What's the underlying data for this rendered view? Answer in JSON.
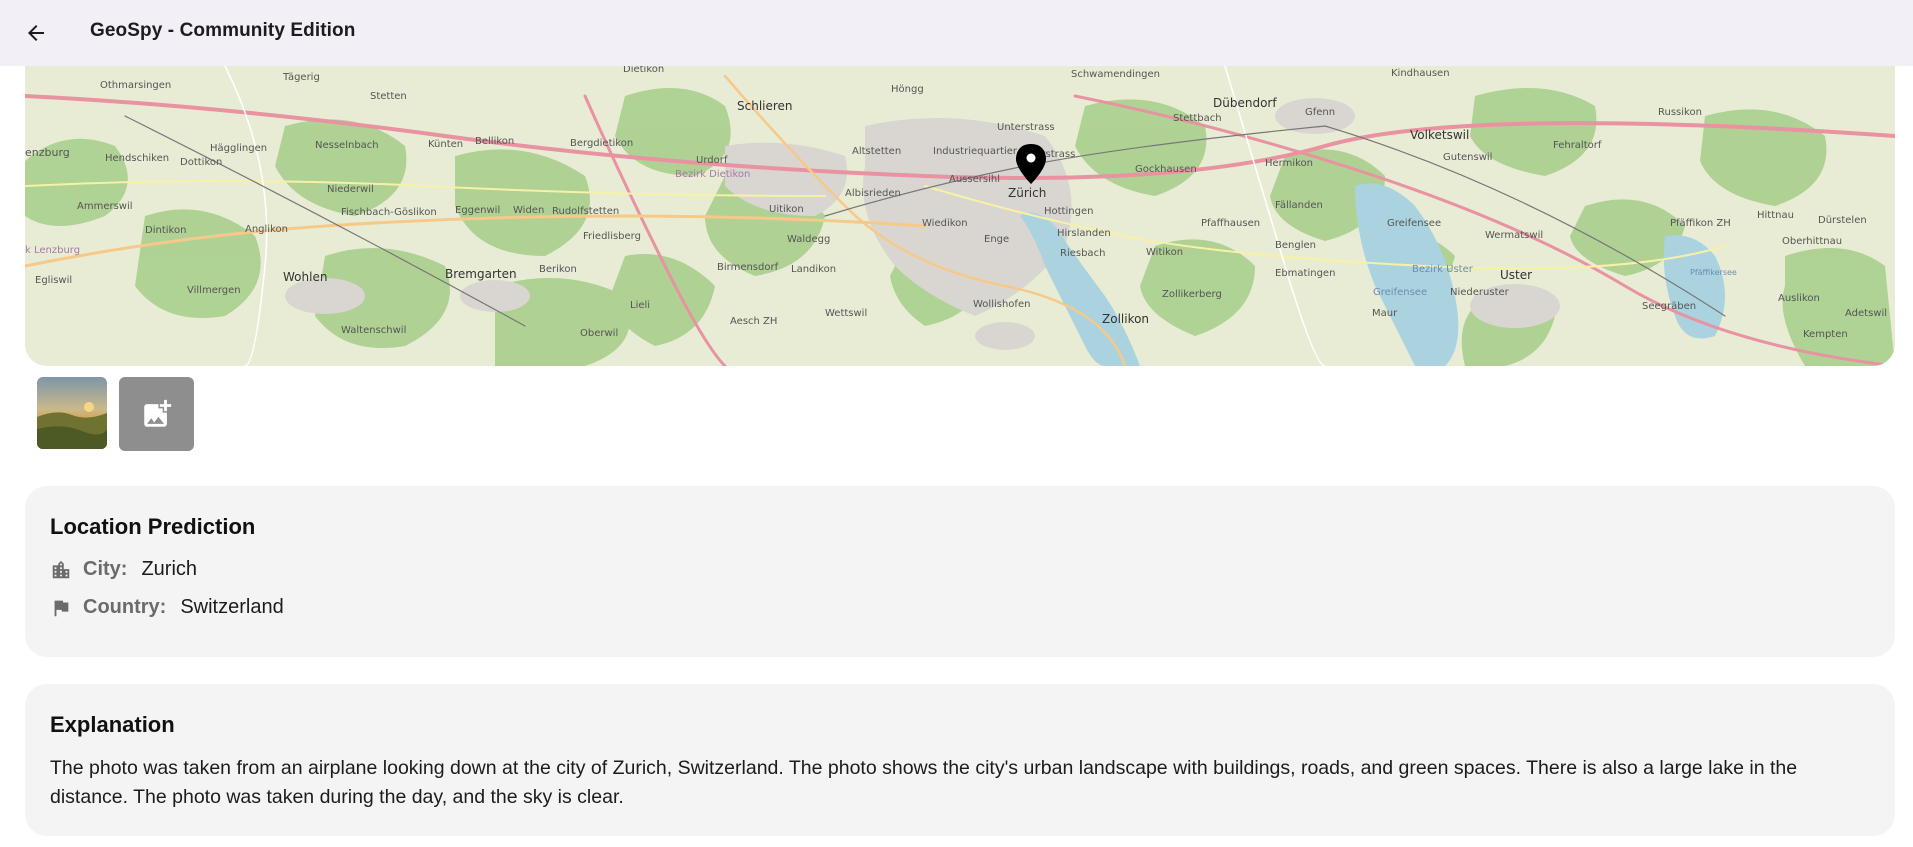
{
  "app": {
    "title": "GeoSpy - Community Edition",
    "back_icon": "arrow-back-icon"
  },
  "map": {
    "marker_icon": "map-pin-icon",
    "labels": [
      "Dietikon",
      "Othmarsingen",
      "Tägerig",
      "Stetten",
      "Schlieren",
      "Höngg",
      "Unterstrass",
      "Oberstrass",
      "Schwamendingen",
      "Dübendorf",
      "Gfenn",
      "Volketswil",
      "Kindhausen",
      "Russikon",
      "Fehraltorf",
      "Gutenswil",
      "Hendschiken",
      "Dottikon",
      "Hägglingen",
      "Nesselnbach",
      "Künten",
      "Bellikon",
      "Bergdietikon",
      "Urdorf",
      "Bezirk Dietikon",
      "Altstetten",
      "Industriequartier",
      "Aussersihl",
      "Zürich",
      "Stettbach",
      "Gockhausen",
      "Hermikon",
      "Niederwil",
      "Fischbach-Göslikon",
      "Eggenwil",
      "Widen",
      "Rudolfstetten",
      "Uitikon",
      "Albisrieden",
      "Wiedikon",
      "Hottingen",
      "Hirslanden",
      "Fällanden",
      "Greifensee",
      "Wermatswil",
      "Pfäffikon ZH",
      "Hittnau",
      "Dürstelen",
      "Ammerswil",
      "Dintikon",
      "Anglikon",
      "Friedlisberg",
      "Waldegg",
      "Enge",
      "Riesbach",
      "Pfaffhausen",
      "Benglen",
      "Oberhittnau",
      "Bezirk Lenzburg",
      "Wohlen",
      "Bremgarten",
      "Berikon",
      "Birmensdorf",
      "Landikon",
      "Witikon",
      "Ebmatingen",
      "Bezirk Uster",
      "Uster",
      "Egliswil",
      "Villmergen",
      "Lieli",
      "Wollishofen",
      "Zollikerberg",
      "Niederuster",
      "Auslikon",
      "Seegräben",
      "Aesch ZH",
      "Wettswil",
      "Zollikon",
      "Maur",
      "Adetswil",
      "Waltenschwil",
      "Oberwil",
      "Kempten",
      "Lenzburg",
      "Pfäffikersee"
    ]
  },
  "photos": {
    "thumbnail_name": "uploaded-photo",
    "add_icon": "add-photo-icon"
  },
  "location": {
    "title": "Location Prediction",
    "city_label": "City:",
    "city_value": "Zurich",
    "city_icon": "city-icon",
    "country_label": "Country:",
    "country_value": "Switzerland",
    "country_icon": "flag-icon"
  },
  "explanation": {
    "title": "Explanation",
    "text": "The photo was taken from an airplane looking down at the city of Zurich, Switzerland. The photo shows the city's urban landscape with buildings, roads, and green spaces. There is also a large lake in the distance. The photo was taken during the day, and the sky is clear."
  }
}
